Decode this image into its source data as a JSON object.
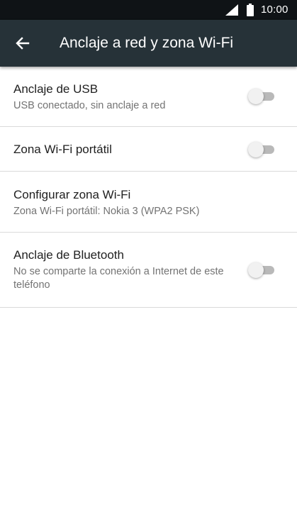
{
  "status_bar": {
    "time": "10:00",
    "icons": [
      "signal-icon",
      "battery-icon"
    ]
  },
  "app_bar": {
    "back_icon": "arrow-left-icon",
    "title": "Anclaje a red y zona Wi-Fi",
    "color": "#263238"
  },
  "settings": [
    {
      "title": "Anclaje de USB",
      "summary": "USB conectado, sin anclaje a red",
      "toggle_on": false
    },
    {
      "title": "Zona Wi-Fi portátil",
      "toggle_on": false
    },
    {
      "title": "Configurar zona Wi-Fi",
      "summary": "Zona Wi-Fi portátil: Nokia 3 (WPA2 PSK)"
    },
    {
      "title": "Anclaje de Bluetooth",
      "summary": "No se comparte la conexión a Internet de este teléfono",
      "toggle_on": false
    }
  ]
}
